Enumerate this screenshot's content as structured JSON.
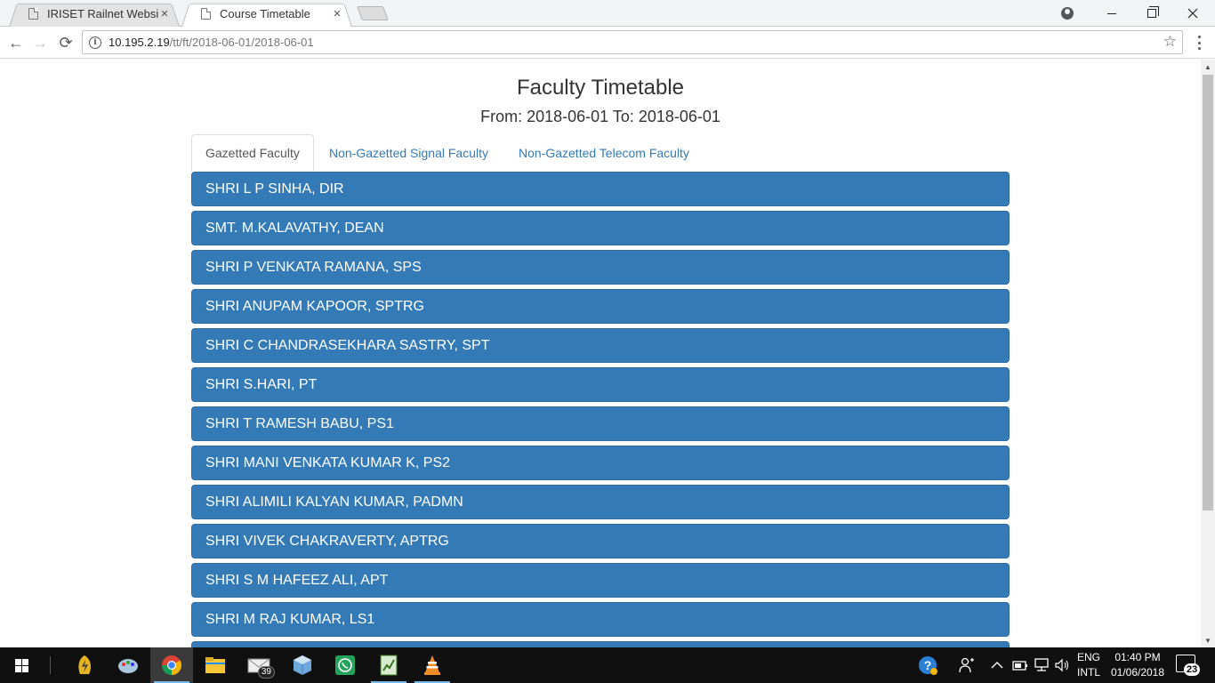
{
  "browser": {
    "tabs": [
      {
        "title": "IRISET Railnet Website",
        "close": "×"
      },
      {
        "title": "Course Timetable",
        "close": "×"
      }
    ],
    "url_host": "10.195.2.19",
    "url_path": "/tt/ft/2018-06-01/2018-06-01",
    "icons": {
      "back": "←",
      "forward": "→",
      "reload": "⟳",
      "star": "☆",
      "info": "i"
    }
  },
  "page": {
    "title": "Faculty Timetable",
    "subtitle": "From: 2018-06-01 To: 2018-06-01",
    "tabs": [
      {
        "label": "Gazetted Faculty"
      },
      {
        "label": "Non-Gazetted Signal Faculty"
      },
      {
        "label": "Non-Gazetted Telecom Faculty"
      }
    ],
    "faculty": [
      "SHRI L P SINHA, DIR",
      "SMT. M.KALAVATHY, DEAN",
      "SHRI P VENKATA RAMANA, SPS",
      "SHRI ANUPAM KAPOOR, SPTRG",
      "SHRI C CHANDRASEKHARA SASTRY, SPT",
      "SHRI S.HARI, PT",
      "SHRI T RAMESH BABU, PS1",
      "SHRI MANI VENKATA KUMAR K, PS2",
      "SHRI ALIMILI KALYAN KUMAR, PADMN",
      "SHRI VIVEK CHAKRAVERTY, APTRG",
      "SHRI S M HAFEEZ ALI, APT",
      "SHRI M RAJ KUMAR, LS1",
      ""
    ]
  },
  "taskbar": {
    "mail_badge": "39",
    "lang_line1": "ENG",
    "lang_line2": "INTL",
    "time": "01:40 PM",
    "date": "01/06/2018",
    "notification_count": "23"
  },
  "colors": {
    "accent": "#337ab7",
    "tab_link": "#337ab7",
    "taskbar": "#101010"
  }
}
